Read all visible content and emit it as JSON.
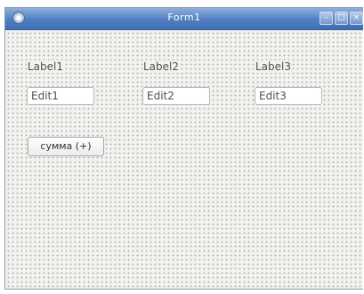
{
  "window": {
    "title": "Form1",
    "controls": {
      "minimize": "–",
      "maximize": "□",
      "close": "×"
    }
  },
  "form": {
    "labels": [
      "Label1",
      "Label2",
      "Label3"
    ],
    "edits": [
      "Edit1",
      "Edit2",
      "Edit3"
    ],
    "button": "сумма (+)"
  }
}
